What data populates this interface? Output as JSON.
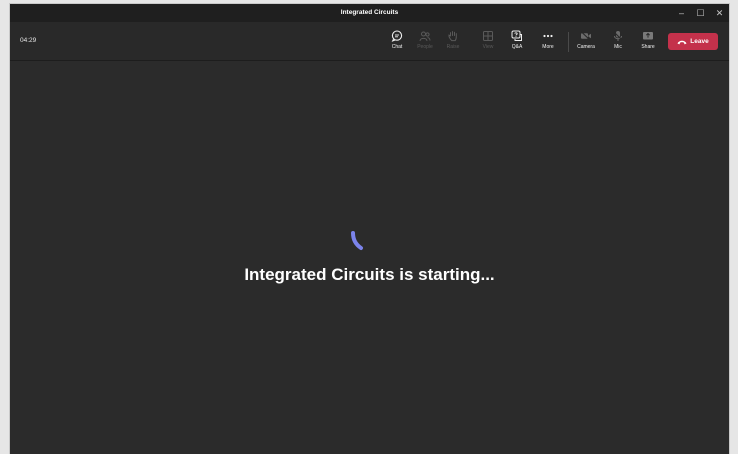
{
  "window": {
    "title": "Integrated Circuits",
    "controls": {
      "minimize": "–",
      "maximize": "☐",
      "close": "✕"
    }
  },
  "toolbar": {
    "timer": "04:29",
    "chat": "Chat",
    "people": "People",
    "raise": "Raise",
    "view": "View",
    "qa": "Q&A",
    "more": "More",
    "camera": "Camera",
    "mic": "Mic",
    "share": "Share",
    "leave": "Leave"
  },
  "stage": {
    "status": "Integrated Circuits is starting..."
  },
  "colors": {
    "leave": "#c4314b",
    "spinner": "#7b83eb"
  }
}
